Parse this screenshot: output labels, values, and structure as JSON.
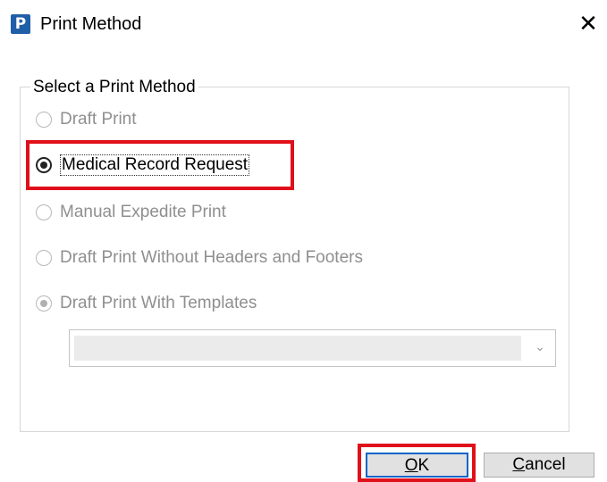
{
  "window": {
    "app_icon_letter": "P",
    "title": "Print Method",
    "close_glyph": "✕"
  },
  "group": {
    "legend": "Select a Print Method",
    "options": [
      {
        "label": "Draft Print",
        "state": "disabled"
      },
      {
        "label": "Medical Record Request",
        "state": "selected"
      },
      {
        "label": "Manual Expedite Print",
        "state": "disabled"
      },
      {
        "label": "Draft Print Without Headers and Footers",
        "state": "disabled"
      },
      {
        "label": "Draft Print With Templates",
        "state": "disabled-checked"
      }
    ],
    "template_select": {
      "value": "",
      "arrow_glyph": "⌄"
    }
  },
  "buttons": {
    "ok": {
      "label_u": "O",
      "label_rest": "K"
    },
    "cancel": {
      "label_u": "C",
      "label_rest": "ancel"
    }
  },
  "colors": {
    "highlight": "#e0101a",
    "focus_border": "#0a64c8",
    "app_icon": "#1f5fa8"
  }
}
